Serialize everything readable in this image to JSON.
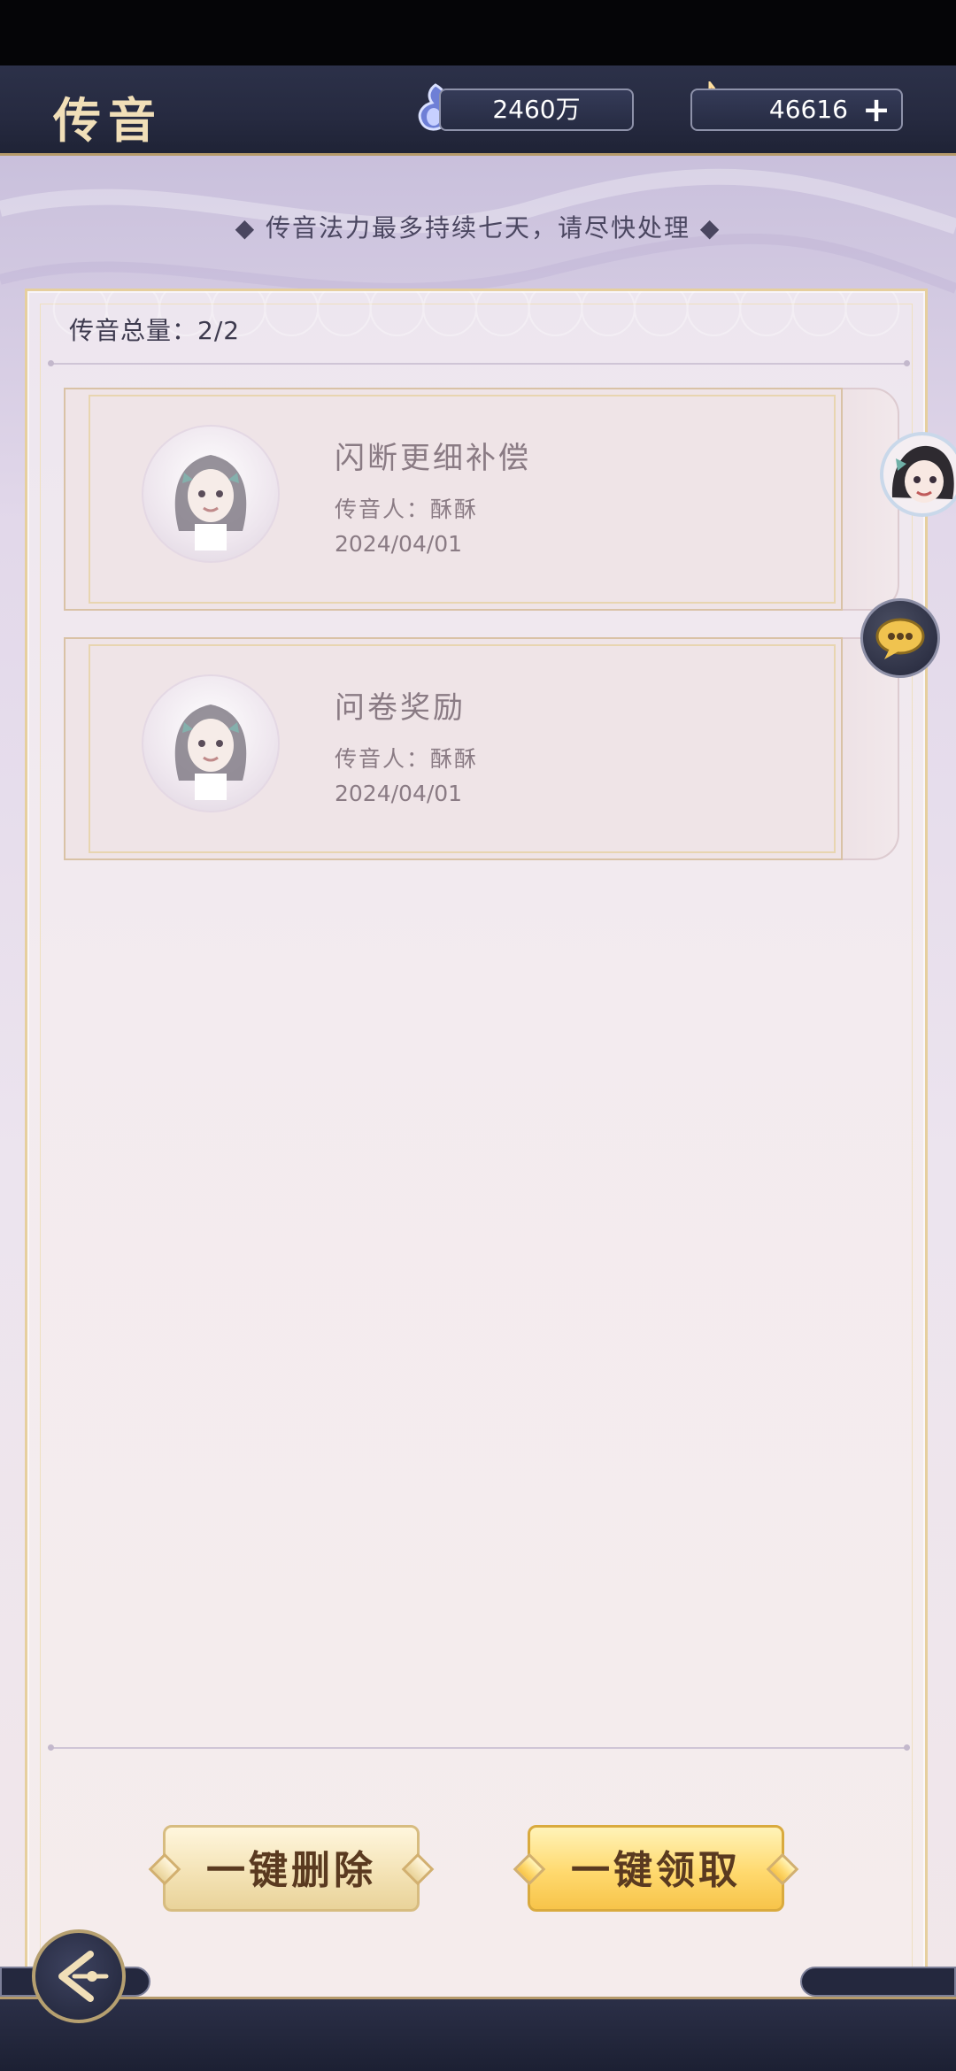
{
  "header": {
    "title": "传音",
    "currency_1": {
      "value": "2460万",
      "icon": "spirit-crystal-icon",
      "color": "#7d8ad6"
    },
    "currency_2": {
      "value": "46616",
      "icon": "flame-jade-icon",
      "color": "#f08a2a",
      "add_label": "+"
    }
  },
  "notice": "◆ 传音法力最多持续七天，请尽快处理 ◆",
  "panel": {
    "total_label": "传音总量：2/2"
  },
  "mails": [
    {
      "title": "闪断更细补偿",
      "sender": "传音人：酥酥",
      "date": "2024/04/01",
      "avatar_icon": "girl-portrait-icon"
    },
    {
      "title": "问卷奖励",
      "sender": "传音人：酥酥",
      "date": "2024/04/01",
      "avatar_icon": "girl-portrait-icon"
    }
  ],
  "side_buttons": {
    "avatar_icon": "character-avatar-icon",
    "chat_icon": "chat-bubble-icon"
  },
  "actions": {
    "delete_all": "一键删除",
    "claim_all": "一键领取"
  },
  "footer": {
    "back_icon": "back-arrow-icon"
  },
  "colors": {
    "accent_gold": "#e6cf9e",
    "header_bg": "#2c3149",
    "text": "#3d3a4e"
  }
}
